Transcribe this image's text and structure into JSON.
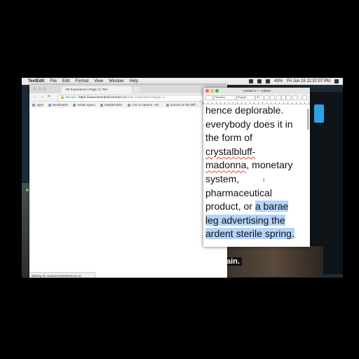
{
  "menubar": {
    "app_name": "TextEdit",
    "items": [
      "File",
      "Edit",
      "Format",
      "View",
      "Window",
      "Help"
    ],
    "clock": "Fri Jun 15  11:37:07 PM",
    "battery": "43%"
  },
  "desktop": {
    "caption_text": "ain."
  },
  "browser": {
    "tab_title": "VR Experience | Page 3 | Terr",
    "url_secure_label": "Secure",
    "url_host": "https://www.terredeshommes.nl",
    "url_path": "/enter-experience?page=2",
    "bookmarks": [
      "Apps",
      "Bookmarks",
      "Artists Space",
      "SimpleAdmin",
      "I Am a Camera - Wi...",
      "Society for the Diff..."
    ],
    "status_text": "Waiting for www.terredeshommes.nl..."
  },
  "textedit": {
    "title": "Untitled 3 — Edited",
    "font_family_value": "Helvetica",
    "font_style_value": "Regular",
    "font_size_value": "24",
    "lines": [
      {
        "parts": [
          {
            "text": "hence deplorable.",
            "style": "normal"
          }
        ]
      },
      {
        "parts": [
          {
            "text": "everybody does it in",
            "style": "normal"
          }
        ]
      },
      {
        "parts": [
          {
            "text": "the form of",
            "style": "normal"
          }
        ]
      },
      {
        "parts": [
          {
            "text": "crystalbluff-",
            "style": "spell"
          }
        ]
      },
      {
        "parts": [
          {
            "text": "madonna",
            "style": "spell"
          },
          {
            "text": ", monetary",
            "style": "normal"
          }
        ]
      },
      {
        "parts": [
          {
            "text": "system,",
            "style": "normal"
          }
        ]
      },
      {
        "parts": [
          {
            "text": "pharmaceutical",
            "style": "normal"
          }
        ]
      },
      {
        "parts": [
          {
            "text": "product, or ",
            "style": "normal"
          },
          {
            "text": "a barae",
            "style": "highlight"
          }
        ]
      },
      {
        "parts": [
          {
            "text": "leg advertising the",
            "style": "highlight"
          }
        ]
      },
      {
        "parts": [
          {
            "text": "ardent sterile spring.",
            "style": "highlight"
          }
        ]
      }
    ]
  },
  "colors": {
    "selection": "#b3d4fc",
    "spellcheck": "#e3423a",
    "secure_green": "#1a8a3a"
  }
}
